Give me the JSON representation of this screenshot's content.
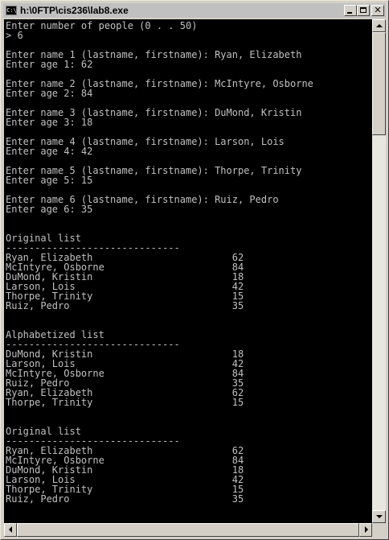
{
  "window": {
    "title": "h:\\0FTP\\cis236\\lab8.exe",
    "icon": "console-app-icon",
    "controls": {
      "minimize": "minimize-icon",
      "maximize": "maximize-icon",
      "close": "✕"
    }
  },
  "console": {
    "text_color": "#c0c0c0",
    "background": "#000000",
    "lines": [
      "Enter number of people (0 . . 50)",
      "> 6",
      "",
      "Enter name 1 (lastname, firstname): Ryan, Elizabeth",
      "Enter age 1: 62",
      "",
      "Enter name 2 (lastname, firstname): McIntyre, Osborne",
      "Enter age 2: 84",
      "",
      "Enter name 3 (lastname, firstname): DuMond, Kristin",
      "Enter age 3: 18",
      "",
      "Enter name 4 (lastname, firstname): Larson, Lois",
      "Enter age 4: 42",
      "",
      "Enter name 5 (lastname, firstname): Thorpe, Trinity",
      "Enter age 5: 15",
      "",
      "Enter name 6 (lastname, firstname): Ruiz, Pedro",
      "Enter age 6: 35",
      "",
      "",
      "Original list",
      "------------------------------",
      "Ryan, Elizabeth                        62",
      "McIntyre, Osborne                      84",
      "DuMond, Kristin                        18",
      "Larson, Lois                           42",
      "Thorpe, Trinity                        15",
      "Ruiz, Pedro                            35",
      "",
      "",
      "Alphabetized list",
      "------------------------------",
      "DuMond, Kristin                        18",
      "Larson, Lois                           42",
      "McIntyre, Osborne                      84",
      "Ruiz, Pedro                            35",
      "Ryan, Elizabeth                        62",
      "Thorpe, Trinity                        15",
      "",
      "",
      "Original list",
      "------------------------------",
      "Ryan, Elizabeth                        62",
      "McIntyre, Osborne                      84",
      "DuMond, Kristin                        18",
      "Larson, Lois                           42",
      "Thorpe, Trinity                        15",
      "Ruiz, Pedro                            35"
    ]
  },
  "scrollbars": {
    "up_icon": "scroll-up-arrow-icon",
    "down_icon": "scroll-down-arrow-icon",
    "left_icon": "scroll-left-arrow-icon",
    "right_icon": "scroll-right-arrow-icon"
  }
}
